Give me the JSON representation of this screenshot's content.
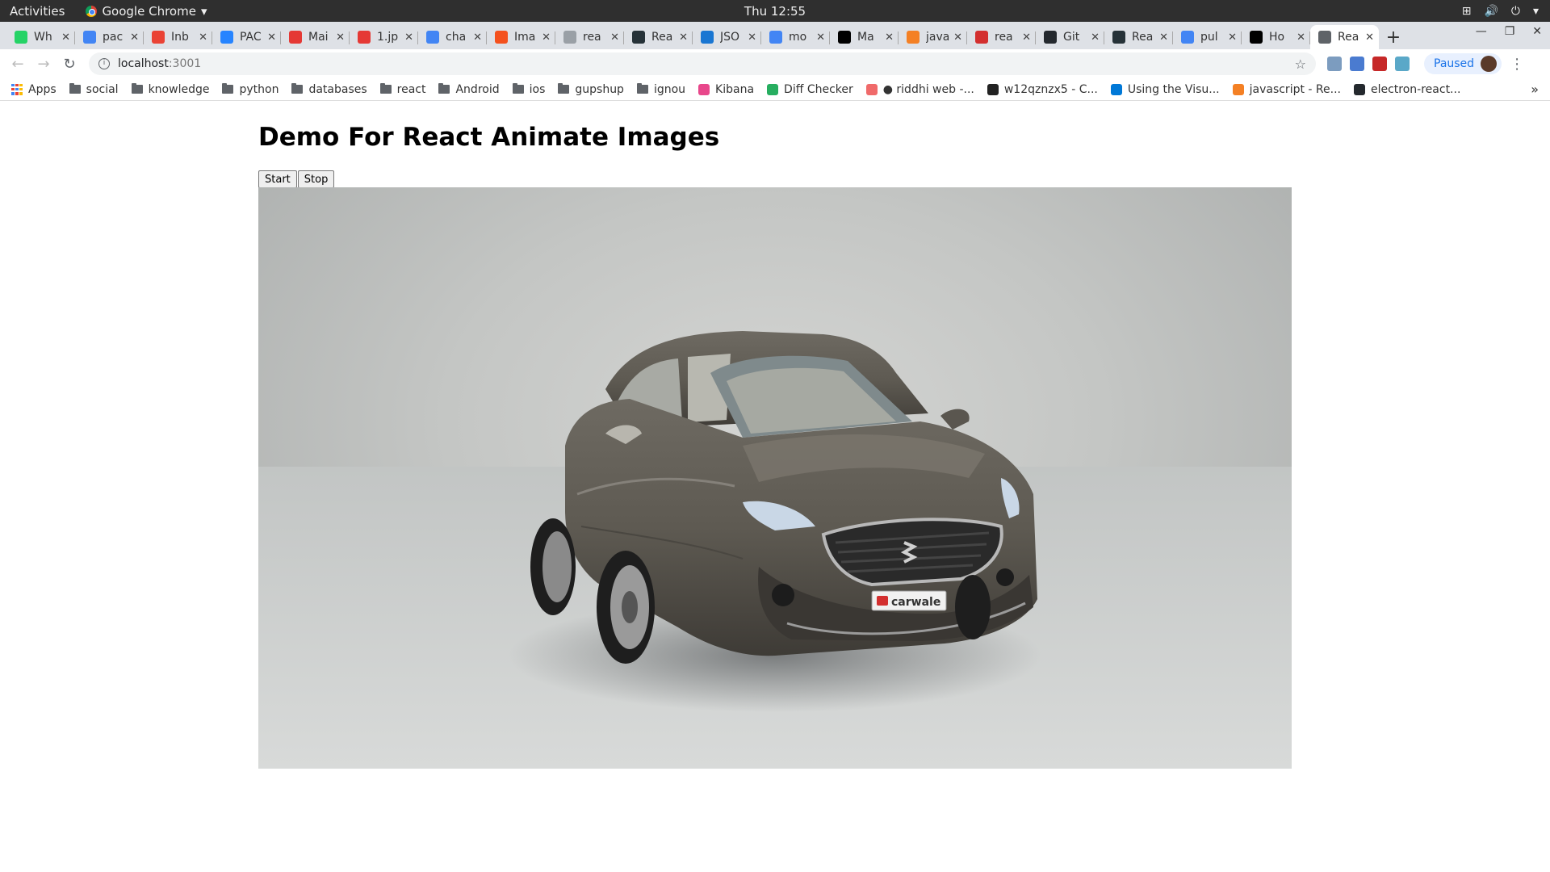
{
  "os_bar": {
    "activities": "Activities",
    "app_name": "Google Chrome",
    "clock": "Thu 12:55"
  },
  "tabs": [
    {
      "title": "Wh",
      "icon_color": "#25d366"
    },
    {
      "title": "pac",
      "icon_color": "#4285f4"
    },
    {
      "title": "Inb",
      "icon_color": "#ea4335"
    },
    {
      "title": "PAC",
      "icon_color": "#2684ff"
    },
    {
      "title": "Mai",
      "icon_color": "#e53935"
    },
    {
      "title": "1.jp",
      "icon_color": "#e53935"
    },
    {
      "title": "cha",
      "icon_color": "#4285f4"
    },
    {
      "title": "Ima",
      "icon_color": "#f4511e"
    },
    {
      "title": "rea",
      "icon_color": "#9aa0a6"
    },
    {
      "title": "Rea",
      "icon_color": "#263238"
    },
    {
      "title": "JSO",
      "icon_color": "#1976d2"
    },
    {
      "title": "mo",
      "icon_color": "#4285f4"
    },
    {
      "title": "Ma",
      "icon_color": "#000000"
    },
    {
      "title": "java",
      "icon_color": "#f48024"
    },
    {
      "title": "rea",
      "icon_color": "#d32f2f"
    },
    {
      "title": "Git",
      "icon_color": "#24292e"
    },
    {
      "title": "Rea",
      "icon_color": "#263238"
    },
    {
      "title": "pul",
      "icon_color": "#4285f4"
    },
    {
      "title": "Ho",
      "icon_color": "#000000"
    },
    {
      "title": "Rea",
      "icon_color": "#5f6368",
      "active": true
    }
  ],
  "toolbar": {
    "url_host": "localhost",
    "url_port": ":3001",
    "profile_status": "Paused"
  },
  "bookmarks": [
    {
      "label": "Apps",
      "kind": "apps"
    },
    {
      "label": "social",
      "kind": "folder"
    },
    {
      "label": "knowledge",
      "kind": "folder"
    },
    {
      "label": "python",
      "kind": "folder"
    },
    {
      "label": "databases",
      "kind": "folder"
    },
    {
      "label": "react",
      "kind": "folder"
    },
    {
      "label": "Android",
      "kind": "folder"
    },
    {
      "label": "ios",
      "kind": "folder"
    },
    {
      "label": "gupshup",
      "kind": "folder"
    },
    {
      "label": "ignou",
      "kind": "folder"
    },
    {
      "label": "Kibana",
      "kind": "site",
      "color": "#e8478b"
    },
    {
      "label": "Diff Checker",
      "kind": "site",
      "color": "#27ae60"
    },
    {
      "label": "● riddhi web -...",
      "kind": "site",
      "color": "#f06a6a"
    },
    {
      "label": "w12qznzx5 - C...",
      "kind": "site",
      "color": "#222222"
    },
    {
      "label": "Using the Visu...",
      "kind": "site",
      "color": "#0078d7"
    },
    {
      "label": "javascript - Re...",
      "kind": "site",
      "color": "#f48024"
    },
    {
      "label": "electron-react...",
      "kind": "site",
      "color": "#24292e"
    }
  ],
  "page": {
    "heading": "Demo For React Animate Images",
    "start_label": "Start",
    "stop_label": "Stop",
    "plate_text": "carwale"
  }
}
